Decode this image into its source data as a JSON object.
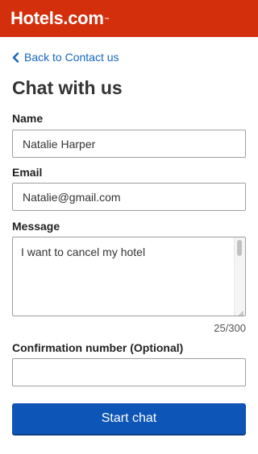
{
  "header": {
    "logo_text": "Hotels.com",
    "logo_tm": "™",
    "brand_color": "#d32f0d"
  },
  "nav": {
    "back_label": "Back to Contact us",
    "back_icon": "chevron-left-icon",
    "link_color": "#1565c0"
  },
  "page": {
    "title": "Chat with us"
  },
  "form": {
    "name": {
      "label": "Name",
      "value": "Natalie Harper"
    },
    "email": {
      "label": "Email",
      "value": "Natalie@gmail.com"
    },
    "message": {
      "label": "Message",
      "value": "I want to cancel my hotel",
      "char_count": "25/300"
    },
    "confirmation": {
      "label": "Confirmation number (Optional)",
      "value": ""
    },
    "submit_label": "Start chat",
    "button_color": "#0d55b6"
  }
}
